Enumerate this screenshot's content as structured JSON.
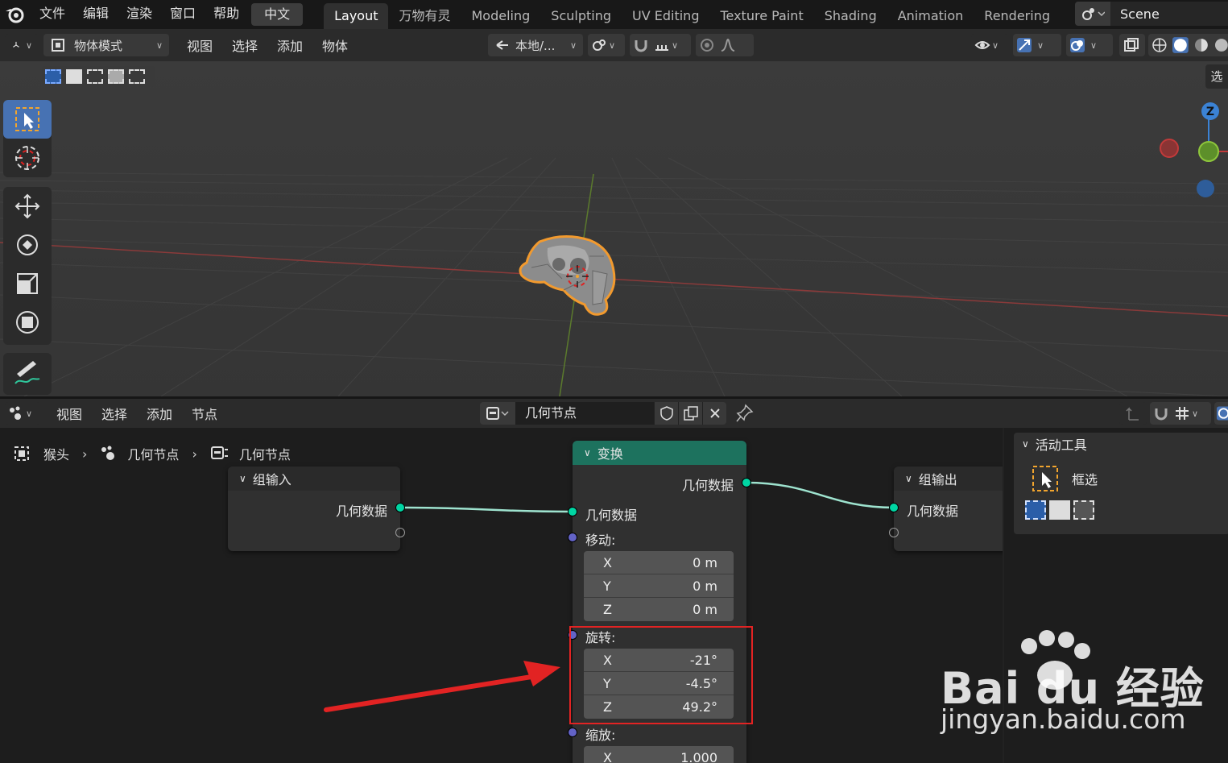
{
  "menu": {
    "items": [
      "文件",
      "编辑",
      "渲染",
      "窗口",
      "帮助"
    ],
    "language": "中文"
  },
  "workspaces": {
    "tabs": [
      "Layout",
      "万物有灵",
      "Modeling",
      "Sculpting",
      "UV Editing",
      "Texture Paint",
      "Shading",
      "Animation",
      "Rendering"
    ],
    "active": "Layout"
  },
  "scene": {
    "name": "Scene"
  },
  "viewport_header": {
    "mode": "物体模式",
    "menus": [
      "视图",
      "选择",
      "添加",
      "物体"
    ],
    "transform_orientation": "本地/..."
  },
  "viewport": {
    "sidebar_tab": "选"
  },
  "node_header": {
    "menus": [
      "视图",
      "选择",
      "添加",
      "节点"
    ],
    "tree_name": "几何节点"
  },
  "breadcrumb": [
    "猴头",
    "几何节点",
    "几何节点"
  ],
  "nodes": {
    "group_input": {
      "title": "组输入",
      "output_geometry": "几何数据"
    },
    "transform": {
      "title": "变换",
      "output_geometry": "几何数据",
      "input_geometry": "几何数据",
      "translation": {
        "label": "移动:",
        "x": {
          "axis": "X",
          "value": "0 m"
        },
        "y": {
          "axis": "Y",
          "value": "0 m"
        },
        "z": {
          "axis": "Z",
          "value": "0 m"
        }
      },
      "rotation": {
        "label": "旋转:",
        "x": {
          "axis": "X",
          "value": "-21°"
        },
        "y": {
          "axis": "Y",
          "value": "-4.5°"
        },
        "z": {
          "axis": "Z",
          "value": "49.2°"
        }
      },
      "scale": {
        "label": "缩放:",
        "x": {
          "axis": "X",
          "value": "1.000"
        }
      }
    },
    "group_output": {
      "title": "组输出",
      "input_geometry": "几何数据"
    }
  },
  "sidebar": {
    "panel_title": "活动工具",
    "tool_name": "框选"
  },
  "watermark": {
    "brand": "Bai du 经验",
    "url": "jingyan.baidu.com"
  },
  "colors": {
    "geometry_socket": "#00d6a3",
    "vector_socket": "#6363c7",
    "transform_header": "#1d725e",
    "highlight": "#e22323",
    "selection_outline": "#f29a2e",
    "active_tool": "#4772b3"
  }
}
